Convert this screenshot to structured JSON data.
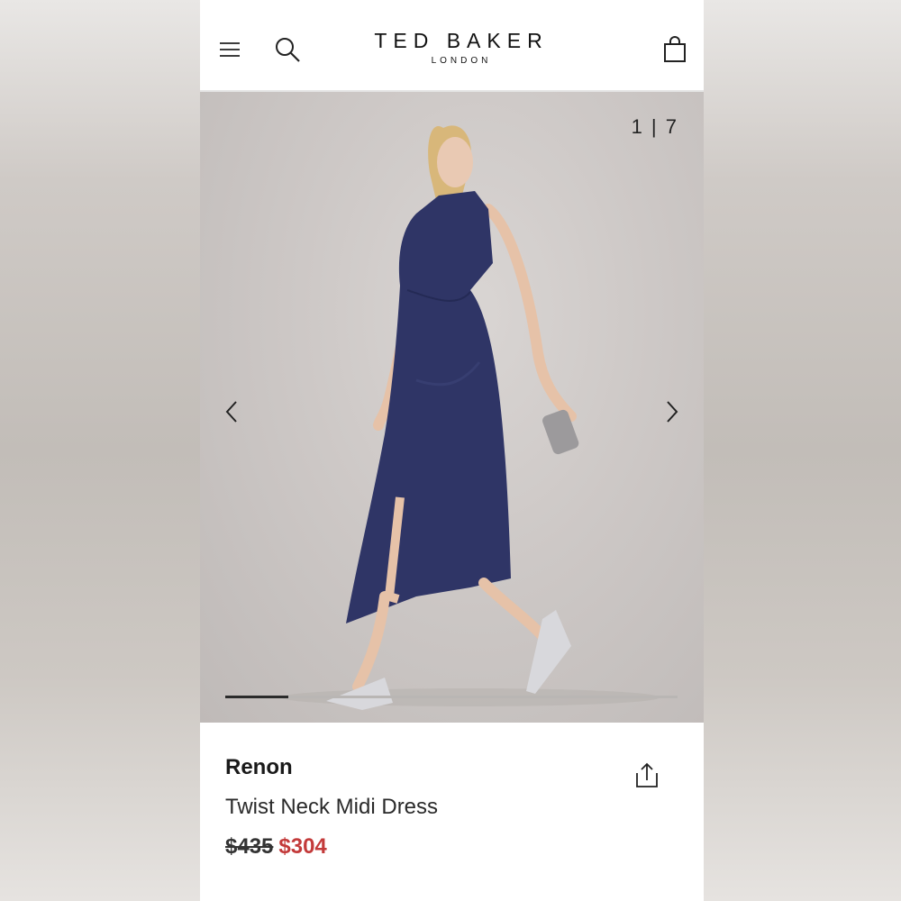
{
  "header": {
    "logo_main": "TED BAKER",
    "logo_sub": "LONDON",
    "icons": {
      "menu": "hamburger-menu-icon",
      "search": "search-icon",
      "bag": "shopping-bag-icon"
    }
  },
  "gallery": {
    "counter": "1 | 7",
    "progress_fraction": 0.14,
    "colors": {
      "dress": "#2f3566",
      "background": "#cdc8c6"
    }
  },
  "product": {
    "brand": "Renon",
    "name": "Twist Neck Midi Dress",
    "old_price": "$435",
    "sale_price": "$304",
    "sale_color": "#c33a3a"
  }
}
